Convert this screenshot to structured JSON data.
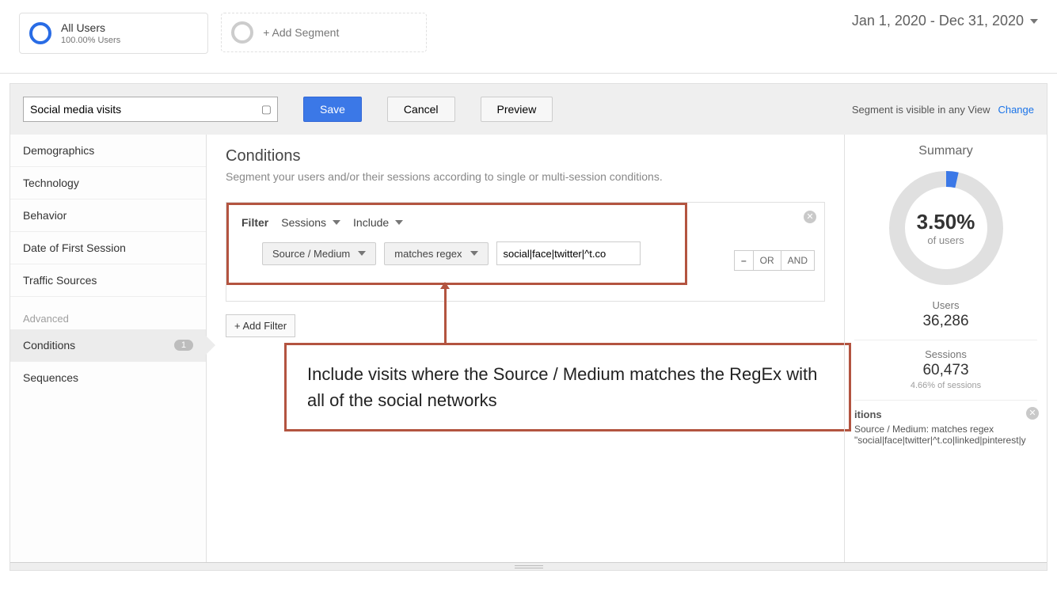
{
  "dateRange": "Jan 1, 2020 - Dec 31, 2020",
  "topSegments": {
    "primary": {
      "title": "All Users",
      "subtitle": "100.00% Users"
    },
    "add": {
      "label": "+ Add Segment"
    }
  },
  "header": {
    "nameValue": "Social media visits",
    "save": "Save",
    "cancel": "Cancel",
    "preview": "Preview",
    "visibilityText": "Segment is visible in any View",
    "changeLink": "Change"
  },
  "sidebar": {
    "items": [
      "Demographics",
      "Technology",
      "Behavior",
      "Date of First Session",
      "Traffic Sources"
    ],
    "advancedLabel": "Advanced",
    "advanced": [
      {
        "label": "Conditions",
        "count": "1",
        "active": true
      },
      {
        "label": "Sequences"
      }
    ]
  },
  "center": {
    "title": "Conditions",
    "subtitle": "Segment your users and/or their sessions according to single or multi-session conditions.",
    "filterLabel": "Filter",
    "scope": "Sessions",
    "includeExclude": "Include",
    "dimension": "Source / Medium",
    "matchType": "matches regex",
    "value": "social|face|twitter|^t.co",
    "logic": {
      "minus": "–",
      "or": "OR",
      "and": "AND"
    },
    "addFilter": "+ Add Filter",
    "callout": "Include visits where the Source / Medium matches the RegEx with all of the social networks"
  },
  "summary": {
    "title": "Summary",
    "percent": "3.50%",
    "percentFraction": 0.035,
    "ofUsers": "of users",
    "users": {
      "label": "Users",
      "value": "36,286"
    },
    "sessions": {
      "label": "Sessions",
      "value": "60,473",
      "sub": "4.66% of sessions"
    },
    "conditionsTitle": "itions",
    "conditionsText": "Source / Medium: matches regex \"social|face|twitter|^t.co|linked|pinterest|y"
  }
}
